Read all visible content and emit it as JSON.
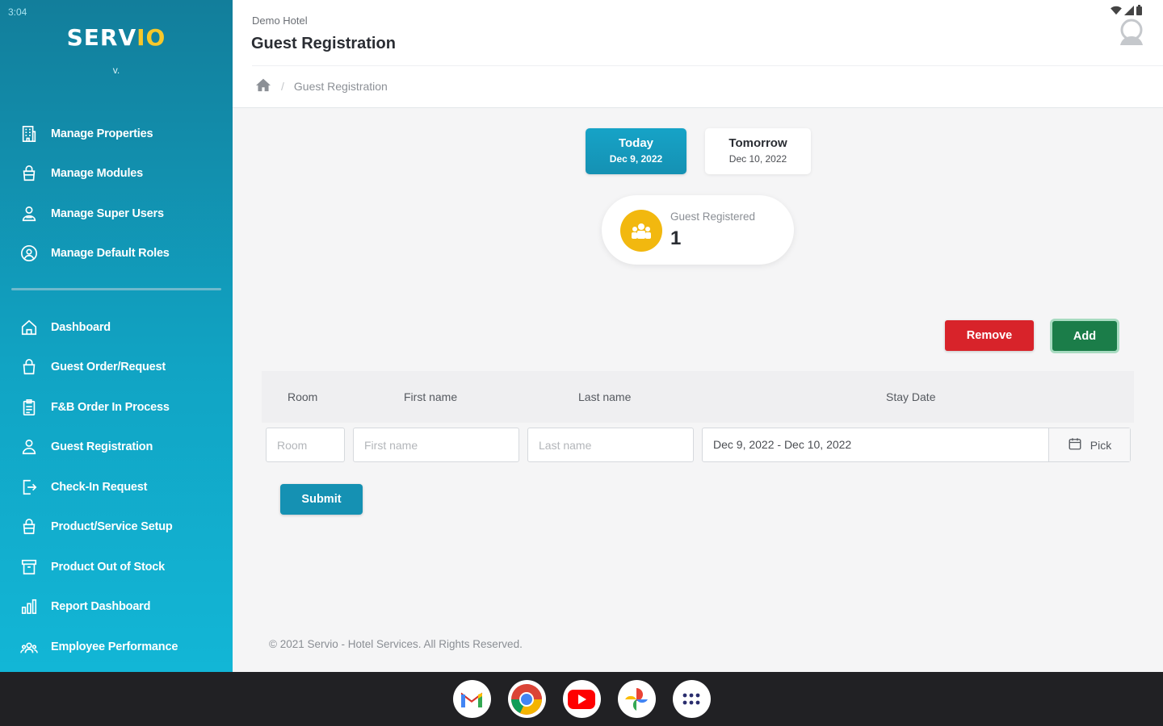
{
  "status": {
    "time": "3:04"
  },
  "sidebar": {
    "logo_main": "SERV",
    "logo_accent": "IO",
    "version": "v.",
    "top_items": [
      {
        "label": "Manage Properties"
      },
      {
        "label": "Manage Modules"
      },
      {
        "label": "Manage Super Users"
      },
      {
        "label": "Manage Default Roles"
      }
    ],
    "items": [
      {
        "label": "Dashboard"
      },
      {
        "label": "Guest Order/Request"
      },
      {
        "label": "F&B Order In Process"
      },
      {
        "label": "Guest Registration"
      },
      {
        "label": "Check-In Request"
      },
      {
        "label": "Product/Service Setup"
      },
      {
        "label": "Product Out of Stock"
      },
      {
        "label": "Report Dashboard"
      },
      {
        "label": "Employee Performance"
      }
    ]
  },
  "header": {
    "hotel": "Demo Hotel",
    "title": "Guest Registration",
    "breadcrumb": "Guest Registration"
  },
  "dates": {
    "today_label": "Today",
    "today_date": "Dec 9, 2022",
    "tomorrow_label": "Tomorrow",
    "tomorrow_date": "Dec 10, 2022"
  },
  "registered": {
    "label": "Guest Registered",
    "count": "1"
  },
  "actions": {
    "remove": "Remove",
    "add": "Add",
    "submit": "Submit"
  },
  "table": {
    "headers": {
      "room": "Room",
      "first": "First name",
      "last": "Last name",
      "stay": "Stay Date"
    },
    "placeholders": {
      "room": "Room",
      "first": "First name",
      "last": "Last name"
    },
    "stay_value": "Dec 9, 2022 - Dec 10, 2022",
    "pick": "Pick"
  },
  "footer": "© 2021 Servio - Hotel Services. All Rights Reserved.",
  "colors": {
    "sidebar": "#1192b3",
    "primary": "#1591b3",
    "danger": "#d8232a",
    "success": "#1b7d49",
    "accent": "#f2b80f"
  }
}
